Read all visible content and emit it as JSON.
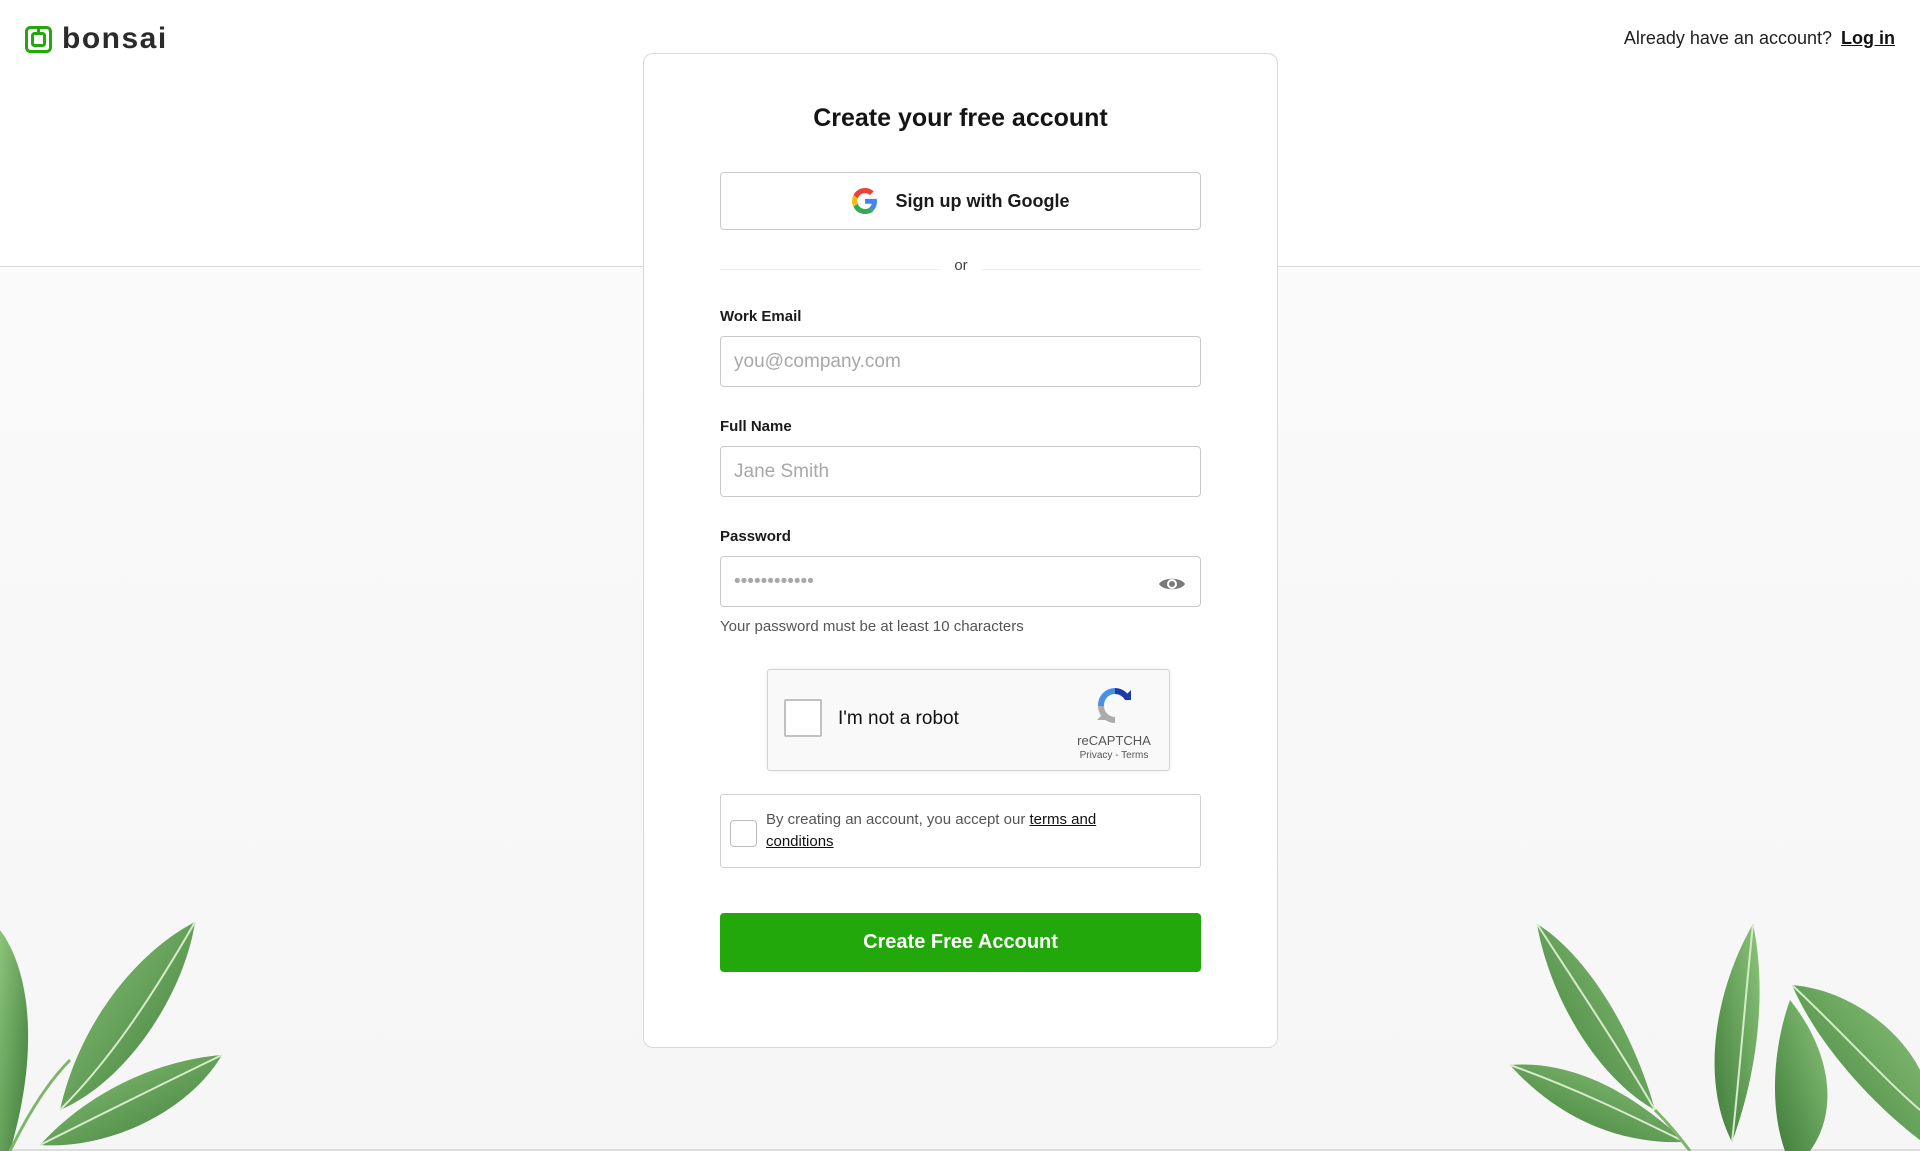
{
  "brand": {
    "name": "bonsai",
    "accent": "#22a80a"
  },
  "header": {
    "login_prompt": "Already have an account?",
    "login_link": "Log in"
  },
  "signup": {
    "title": "Create your free account",
    "google_label": "Sign up with Google",
    "divider_text": "or",
    "email": {
      "label": "Work Email",
      "placeholder": "you@company.com"
    },
    "name": {
      "label": "Full Name",
      "placeholder": "Jane Smith"
    },
    "password": {
      "label": "Password",
      "placeholder": "••••••••••••",
      "hint": "Your password must be at least 10 characters"
    },
    "recaptcha": {
      "label": "I'm not a robot",
      "brand": "reCAPTCHA",
      "privacy": "Privacy",
      "terms": "Terms",
      "separator": " - "
    },
    "terms": {
      "prefix": "By creating an account, you accept our ",
      "link_text": "terms and conditions"
    },
    "submit_label": "Create Free Account"
  },
  "icons": {
    "logo": "bonsai-logo-icon",
    "google": "google-icon",
    "eye": "eye-icon",
    "recaptcha": "recaptcha-logo-icon"
  }
}
